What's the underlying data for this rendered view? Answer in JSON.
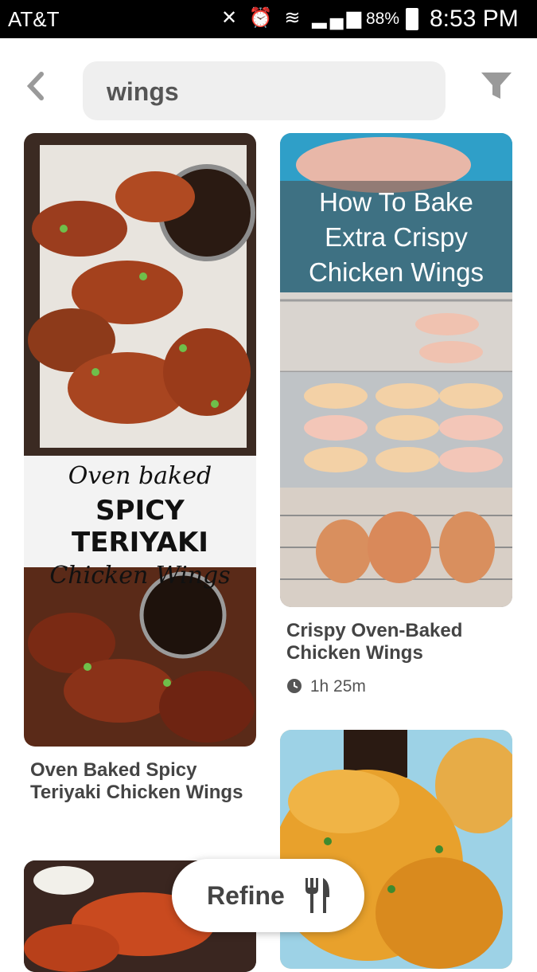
{
  "status_bar": {
    "carrier": "AT&T",
    "battery": "88%",
    "time": "8:53 PM"
  },
  "search": {
    "query": "wings"
  },
  "pins": [
    {
      "title": "Oven Baked Spicy Teriyaki Chicken Wings",
      "image_text": {
        "line1": "Oven baked",
        "line2": "SPICY TERIYAKI",
        "line3": "Chicken Wings"
      }
    },
    {
      "title": "Crispy Oven-Baked Chicken Wings",
      "time": "1h 25m",
      "image_text": {
        "line1": "How To Bake",
        "line2": "Extra Crispy",
        "line3": "Chicken Wings"
      }
    }
  ],
  "refine": {
    "label": "Refine"
  },
  "icons": [
    "back-icon",
    "filter-icon",
    "wifi-icon",
    "signal-icon",
    "alarm-icon",
    "clock-icon",
    "fork-knife-icon"
  ],
  "colors": {
    "status_bar": "#000000",
    "search_bg": "#efefef",
    "text_gray": "#444444"
  }
}
